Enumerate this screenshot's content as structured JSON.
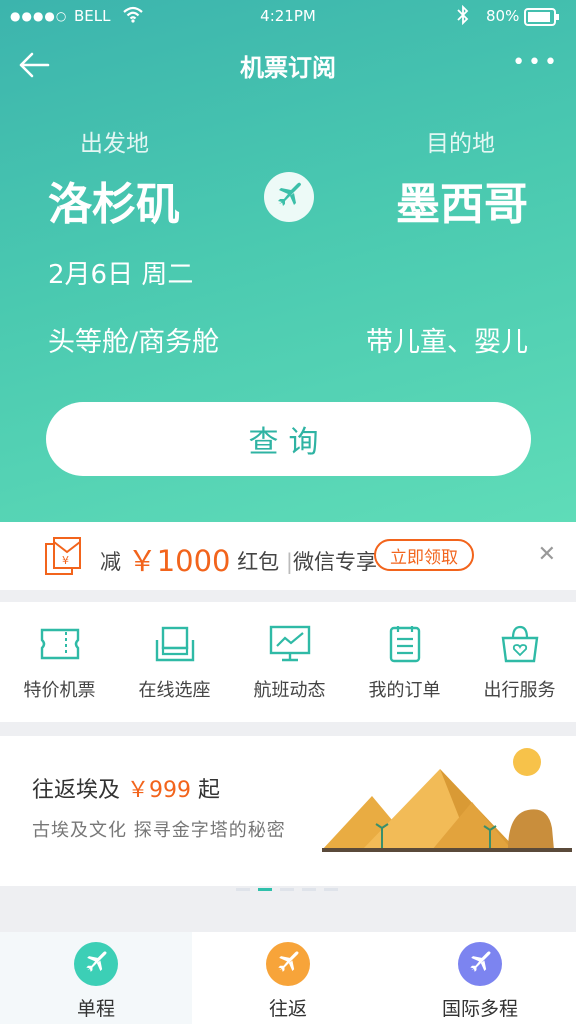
{
  "status_bar": {
    "carrier": "BELL",
    "time": "4:21PM",
    "battery": "80%"
  },
  "nav": {
    "title": "机票订阅"
  },
  "route": {
    "from_label": "出发地",
    "from_city": "洛杉矶",
    "to_label": "目的地",
    "to_city": "墨西哥",
    "date": "2月6日 周二",
    "cabin": "头等舱/商务舱",
    "passengers": "带儿童、婴儿"
  },
  "search_label": "查询",
  "promo": {
    "prefix": "减",
    "amount": "￥1000",
    "suffix": "红包",
    "tag": "微信专享",
    "claim_label": "立即领取"
  },
  "services": [
    {
      "label": "特价机票",
      "icon": "ticket-icon"
    },
    {
      "label": "在线选座",
      "icon": "seat-icon"
    },
    {
      "label": "航班动态",
      "icon": "monitor-chart-icon"
    },
    {
      "label": "我的订单",
      "icon": "clipboard-icon"
    },
    {
      "label": "出行服务",
      "icon": "bag-heart-icon"
    }
  ],
  "banner": {
    "title": "往返埃及",
    "price": "￥999",
    "suffix": "起",
    "subtitle": "古埃及文化  探寻金字塔的秘密"
  },
  "tabs": [
    {
      "label": "单程",
      "color": "#3ccfb6",
      "active": true
    },
    {
      "label": "往返",
      "color": "#f7a43a",
      "active": false
    },
    {
      "label": "国际多程",
      "color": "#7c84f0",
      "active": false
    }
  ],
  "colors": {
    "accent": "#2fb3a3",
    "promo": "#f2641c"
  }
}
